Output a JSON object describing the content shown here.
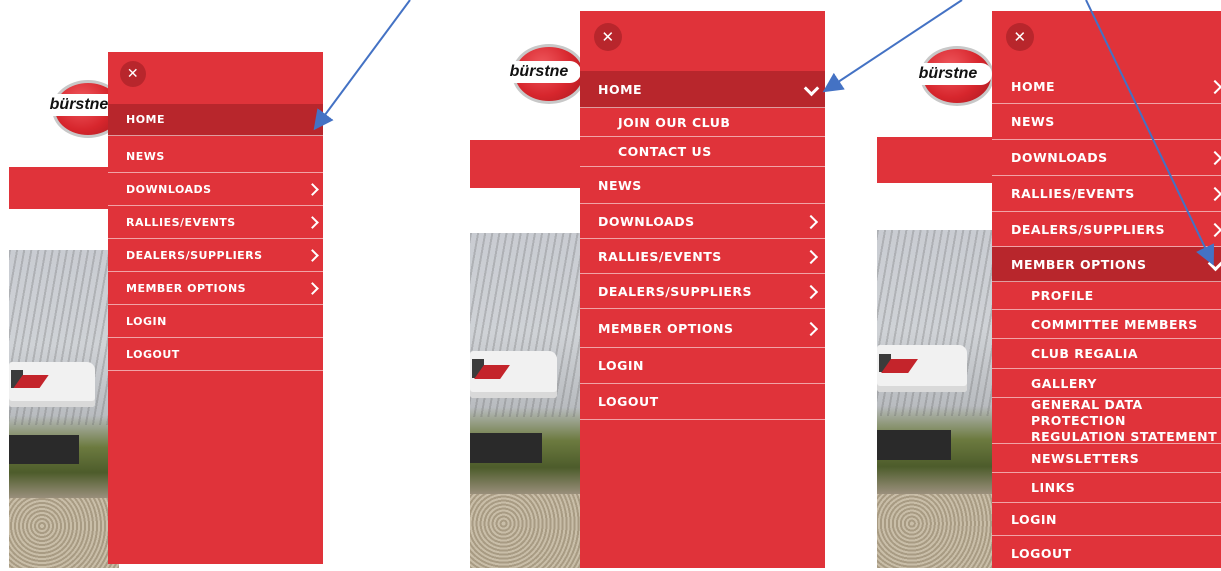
{
  "logo": {
    "text": "bürstne"
  },
  "close_symbol": "✕",
  "menu1": {
    "items": [
      {
        "label": "HOME",
        "active": true,
        "chevron": false
      },
      {
        "label": "NEWS",
        "chevron": false
      },
      {
        "label": "DOWNLOADS",
        "chevron": true
      },
      {
        "label": "RALLIES/EVENTS",
        "chevron": true
      },
      {
        "label": "DEALERS/SUPPLIERS",
        "chevron": true
      },
      {
        "label": "MEMBER OPTIONS",
        "chevron": true
      },
      {
        "label": "LOGIN",
        "chevron": false
      },
      {
        "label": "LOGOUT",
        "chevron": false
      }
    ]
  },
  "menu2": {
    "items": [
      {
        "label": "HOME",
        "active": true,
        "chevron": "down"
      },
      {
        "label": "JOIN OUR CLUB",
        "sub": true
      },
      {
        "label": "CONTACT US",
        "sub": true
      },
      {
        "label": "NEWS"
      },
      {
        "label": "DOWNLOADS",
        "chevron": true
      },
      {
        "label": "RALLIES/EVENTS",
        "chevron": true
      },
      {
        "label": "DEALERS/SUPPLIERS",
        "chevron": true
      },
      {
        "label": "MEMBER OPTIONS",
        "chevron": true
      },
      {
        "label": "LOGIN"
      },
      {
        "label": "LOGOUT"
      }
    ]
  },
  "menu3": {
    "items": [
      {
        "label": "HOME",
        "chevron": true
      },
      {
        "label": "NEWS"
      },
      {
        "label": "DOWNLOADS",
        "chevron": true
      },
      {
        "label": "RALLIES/EVENTS",
        "chevron": true
      },
      {
        "label": "DEALERS/SUPPLIERS",
        "chevron": true
      },
      {
        "label": "MEMBER OPTIONS",
        "active": true,
        "chevron": "down"
      },
      {
        "label": "PROFILE",
        "sub": true
      },
      {
        "label": "COMMITTEE MEMBERS",
        "sub": true
      },
      {
        "label": "CLUB REGALIA",
        "sub": true
      },
      {
        "label": "GALLERY",
        "sub": true
      },
      {
        "label": "GENERAL DATA PROTECTION REGULATION STATEMENT",
        "sub": true,
        "two_line": true
      },
      {
        "label": "NEWSLETTERS",
        "sub": true
      },
      {
        "label": "LINKS",
        "sub": true
      },
      {
        "label": "LOGIN"
      },
      {
        "label": "LOGOUT"
      }
    ]
  },
  "colors": {
    "menu_red": "#e0333a",
    "active_red": "#b8262c",
    "arrow_blue": "#4472c4"
  }
}
